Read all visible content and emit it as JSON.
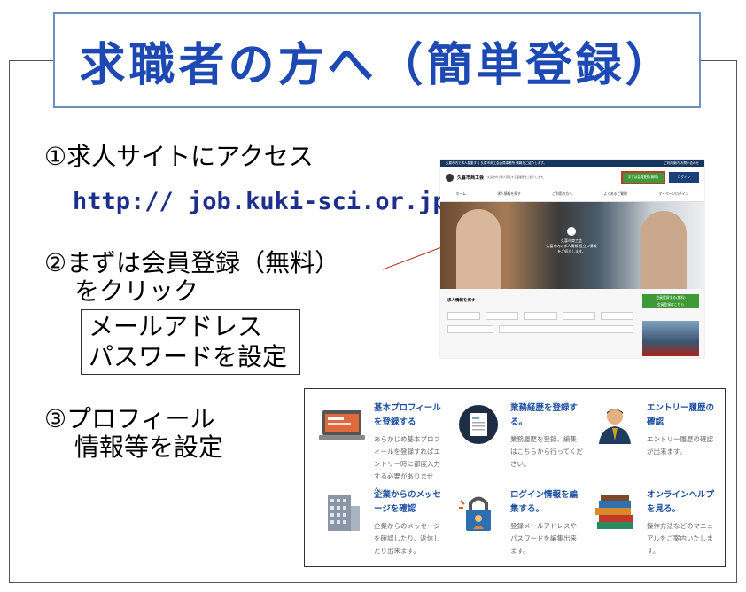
{
  "title": "求職者の方へ（簡単登録）",
  "steps": {
    "step1": "①求人サイトにアクセス",
    "url": "http:// job.kuki-sci.or.jp",
    "step2_line1": "②まずは会員登録（無料）",
    "step2_line2": "をクリック",
    "note_line1": "メールアドレス",
    "note_line2": "パスワードを設定",
    "step3_line1": "③プロフィール",
    "step3_line2": "情報等を設定"
  },
  "site": {
    "topbar_left": "久喜市内で求人募集する 久喜市商工会会員事業所 情報をご紹介します。",
    "topbar_right": "ご利用案内 お問い合わせ",
    "logo": "久喜市商工会",
    "header_small": "久喜市内で求人募集する事業所をご紹介します。",
    "register_btn": "まずは会員登録(無料)",
    "login_btn": "ログイン",
    "nav": [
      "ホーム",
      "求人情報を探す",
      "ご利用の方へ",
      "よくあるご質問",
      "マイページログイン"
    ],
    "hero_logo": "久喜市商工会",
    "hero_text": "久喜市内の求人情報 役立つ情報をご紹介します。",
    "search_title": "求人情報を探す",
    "cta": "会員登録する(無料)",
    "cta_sub": "会員登録はこちら",
    "side_caption": "幸運採用を目指す人の企業事例"
  },
  "panel": {
    "items": [
      {
        "title": "基本プロフィールを登録する",
        "desc": "あらかじめ基本プロフィールを登録すればエントリー時に都度入力する必要がありません。",
        "icon": "laptop-icon"
      },
      {
        "title": "業務経歴を登録する。",
        "desc": "業務履歴を登録、編集はこちらから行ってください。",
        "icon": "document-icon"
      },
      {
        "title": "エントリー履歴の確認",
        "desc": "エントリー履歴の確認が出来ます。",
        "icon": "businessman-icon"
      },
      {
        "title": "企業からのメッセージを確認",
        "desc": "企業からのメッセージを確認したり、返信したり出来ます。",
        "icon": "building-icon"
      },
      {
        "title": "ログイン情報を編集する。",
        "desc": "登録メールアドレスやパスワードを編集出来ます。",
        "icon": "lock-icon"
      },
      {
        "title": "オンラインヘルプを見る。",
        "desc": "操作方法などのマニュアルをご案内いたします。",
        "icon": "books-icon"
      }
    ]
  },
  "colors": {
    "title": "#1c49b3",
    "url": "#1c2f8c",
    "accent_red": "#c0392b",
    "green": "#3d9a37",
    "navy": "#17365d"
  }
}
